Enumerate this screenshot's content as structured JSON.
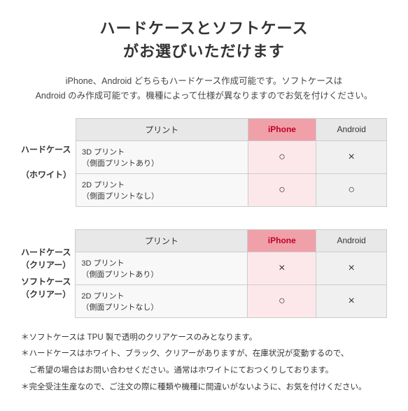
{
  "title": {
    "line1": "ハードケースとソフトケース",
    "line2": "がお選びいただけます"
  },
  "subtitle": "iPhone、Android どちらもハードケース作成可能です。ソフトケースは\nAndroid のみ作成可能です。機種によって仕様が異なりますのでお気を付けください。",
  "table1": {
    "row_header_line1": "ハードケース",
    "row_header_line2": "（ホワイト）",
    "col_print": "プリント",
    "col_iphone": "iPhone",
    "col_android": "Android",
    "rows": [
      {
        "print": "3D プリント\n（側面プリントあり）",
        "iphone": "○",
        "android": "×"
      },
      {
        "print": "2D プリント\n（側面プリントなし）",
        "iphone": "○",
        "android": "○"
      }
    ]
  },
  "table2": {
    "row_header_line1": "ハードケース",
    "row_header_line2": "（クリアー）",
    "row_header2_line1": "ソフトケース",
    "row_header2_line2": "（クリアー）",
    "col_print": "プリント",
    "col_iphone": "iPhone",
    "col_android": "Android",
    "rows": [
      {
        "print": "3D プリント\n（側面プリントあり）",
        "iphone": "×",
        "android": "×"
      },
      {
        "print": "2D プリント\n（側面プリントなし）",
        "iphone": "○",
        "android": "×"
      }
    ]
  },
  "notes": [
    "＊ソフトケースは TPU 製で透明のクリアケースのみとなります。",
    "＊ハードケースはホワイト、ブラック、クリアーがありますが、在庫状況が変動するので、",
    "　ご希望の場合はお問い合わせください。通常はホワイトにておつくりしております。",
    "＊完全受注生産なので、ご注文の際に種類や機種に間違いがないように、お気を付けください。"
  ]
}
